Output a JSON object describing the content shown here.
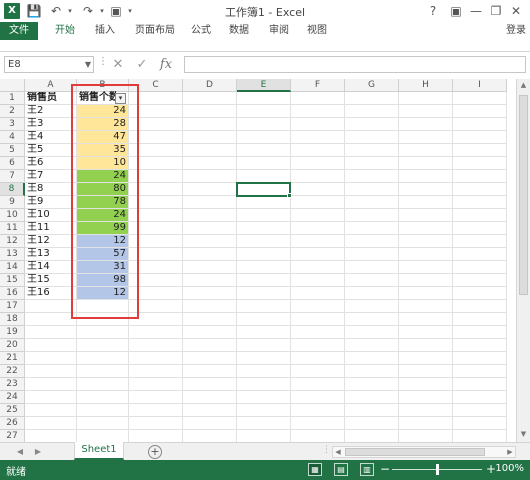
{
  "app": {
    "title": "工作簿1 - Excel",
    "help": "?",
    "login": "登录"
  },
  "ribbon": {
    "tabs": [
      {
        "label": "文件"
      },
      {
        "label": "开始"
      },
      {
        "label": "插入"
      },
      {
        "label": "页面布局"
      },
      {
        "label": "公式"
      },
      {
        "label": "数据"
      },
      {
        "label": "审阅"
      },
      {
        "label": "视图"
      }
    ],
    "active_tab": "开始"
  },
  "formula_bar": {
    "name_box": "E8",
    "fx_label": "fx",
    "value": ""
  },
  "grid": {
    "columns": [
      "A",
      "B",
      "C",
      "D",
      "E",
      "F",
      "G",
      "H",
      "I"
    ],
    "selected_column": "E",
    "selected_row": "8",
    "rows": [
      "1",
      "2",
      "3",
      "4",
      "5",
      "6",
      "7",
      "8",
      "9",
      "10",
      "11",
      "12",
      "13",
      "14",
      "15",
      "16",
      "17",
      "18",
      "19",
      "20",
      "21",
      "22",
      "23",
      "24",
      "25",
      "26",
      "27"
    ],
    "header_row": {
      "a": "销售员",
      "b": "销售个数"
    },
    "data": [
      {
        "name": "王2",
        "sales": "24",
        "group": "yellow"
      },
      {
        "name": "王3",
        "sales": "28",
        "group": "yellow"
      },
      {
        "name": "王4",
        "sales": "47",
        "group": "yellow"
      },
      {
        "name": "王5",
        "sales": "35",
        "group": "yellow"
      },
      {
        "name": "王6",
        "sales": "10",
        "group": "yellow"
      },
      {
        "name": "王7",
        "sales": "24",
        "group": "green"
      },
      {
        "name": "王8",
        "sales": "80",
        "group": "green"
      },
      {
        "name": "王9",
        "sales": "78",
        "group": "green"
      },
      {
        "name": "王10",
        "sales": "24",
        "group": "green"
      },
      {
        "name": "王11",
        "sales": "99",
        "group": "green"
      },
      {
        "name": "王12",
        "sales": "12",
        "group": "blue"
      },
      {
        "name": "王13",
        "sales": "57",
        "group": "blue"
      },
      {
        "name": "王14",
        "sales": "31",
        "group": "blue"
      },
      {
        "name": "王15",
        "sales": "98",
        "group": "blue"
      },
      {
        "name": "王16",
        "sales": "12",
        "group": "blue"
      }
    ],
    "fill_colors": {
      "yellow": "#ffe699",
      "green": "#92d050",
      "blue": "#b4c6e7"
    }
  },
  "sheets": {
    "tabs": [
      "Sheet1"
    ],
    "add_symbol": "⊕"
  },
  "status": {
    "ready": "就绪",
    "zoom": "100%",
    "zoom_level_percent": 100
  },
  "colors": {
    "accent": "#217346",
    "annotation": "#e03c3c"
  }
}
